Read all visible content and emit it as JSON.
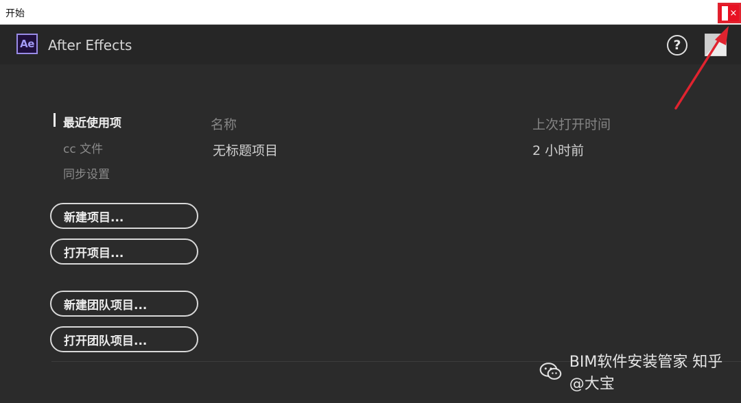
{
  "window": {
    "title": "开始",
    "close_symbol": "×"
  },
  "header": {
    "logo_text": "Ae",
    "app_name": "After Effects",
    "help_symbol": "?"
  },
  "nav": {
    "items": [
      {
        "label": "最近使用项"
      },
      {
        "label": "cc 文件"
      },
      {
        "label": "同步设置"
      }
    ]
  },
  "actions": {
    "buttons": [
      {
        "label": "新建项目..."
      },
      {
        "label": "打开项目..."
      },
      {
        "label": "新建团队项目..."
      },
      {
        "label": "打开团队项目..."
      }
    ]
  },
  "recent": {
    "columns": [
      "名称",
      "上次打开时间"
    ],
    "rows": [
      {
        "name": "无标题项目",
        "opened": "2 小时前"
      }
    ]
  },
  "watermark": {
    "text": "BIM软件安装管家  知乎 @大宝"
  },
  "colors": {
    "panel_bg": "#2b2b2b",
    "header_bg": "#262626",
    "accent_close": "#e81123",
    "annotation_arrow": "#e0232f",
    "logo_border": "#9a8ce8"
  }
}
